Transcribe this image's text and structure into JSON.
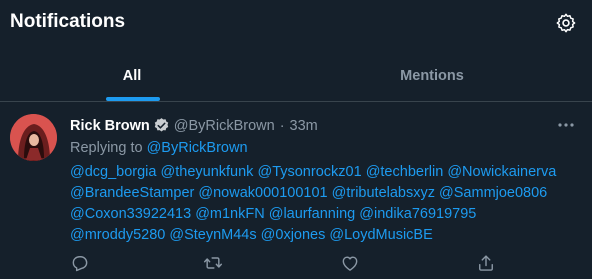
{
  "header": {
    "title": "Notifications"
  },
  "tabs": [
    {
      "label": "All"
    },
    {
      "label": "Mentions"
    }
  ],
  "colors": {
    "background": "#15202b",
    "accent": "#1d9bf0",
    "muted": "#8b98a5"
  },
  "tweet": {
    "author_name": "Rick Brown",
    "author_handle": "@ByRickBrown",
    "separator": "·",
    "time": "33m",
    "replying_prefix": "Replying to",
    "replying_handle": "@ByRickBrown",
    "mentions": [
      "@dcg_borgia",
      "@theyunkfunk",
      "@Tysonrockz01",
      "@techberlin",
      "@Nowickainerva",
      "@BrandeeStamper",
      "@nowak000100101",
      "@tributelabsxyz",
      "@Sammjoe0806",
      "@Coxon33922413",
      "@m1nkFN",
      "@laurfanning",
      "@indika76919795",
      "@mroddy5280",
      "@SteynM44s",
      "@0xjones",
      "@LoydMusicBE"
    ],
    "icons": [
      "verified-badge-icon",
      "more-icon",
      "reply-icon",
      "retweet-icon",
      "like-icon",
      "share-icon"
    ]
  }
}
